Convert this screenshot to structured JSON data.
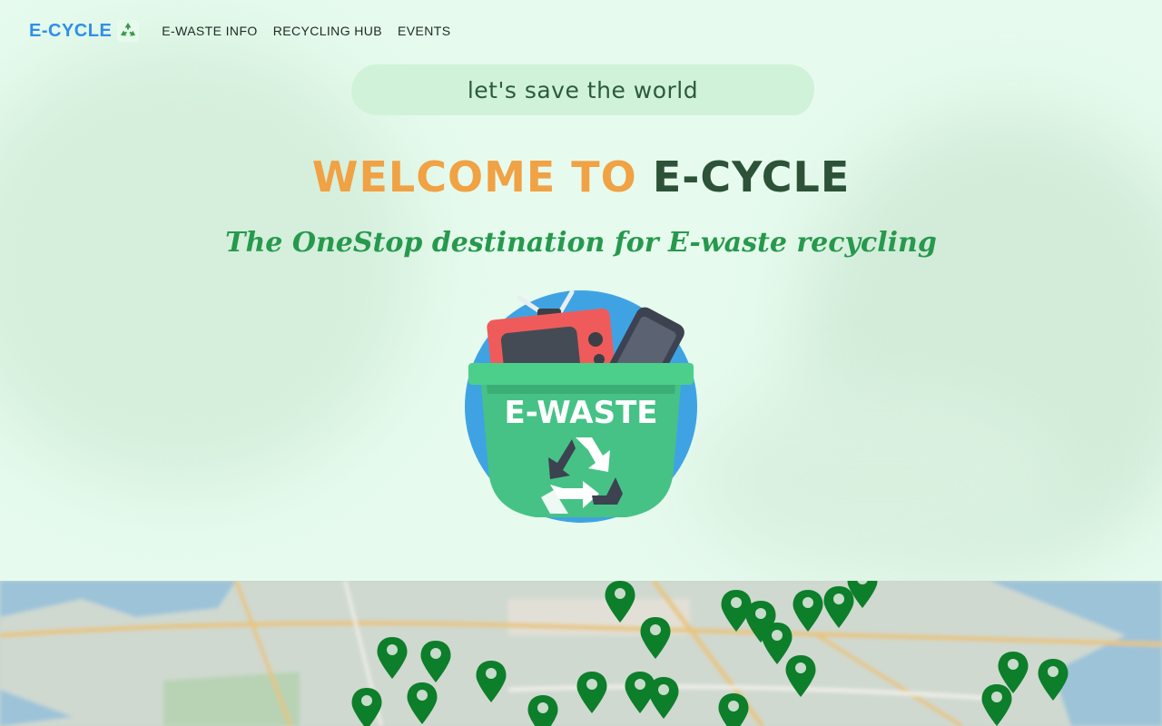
{
  "brand": {
    "name": "E-CYCLE",
    "icon": "recycle-icon",
    "color": "#2f8fe8"
  },
  "nav": {
    "items": [
      {
        "label": "E-WASTE INFO"
      },
      {
        "label": "RECYCLING HUB"
      },
      {
        "label": "EVENTS"
      }
    ]
  },
  "hero": {
    "tagline": "let's save the world",
    "welcome_prefix": "WELCOME TO",
    "welcome_brand": "E-CYCLE",
    "subtitle": "The OneStop destination for E-waste recycling",
    "illustration": {
      "label": "E-WASTE",
      "icons": [
        "tv-icon",
        "phone-icon",
        "recycle-icon"
      ]
    }
  },
  "map": {
    "marker_icon": "map-pin-icon",
    "marker_color": "#0e8a2b"
  },
  "colors": {
    "background": "#e6fbee",
    "accent_orange": "#f0a244",
    "dark_green": "#2c5238",
    "subtitle_green": "#26994d",
    "pill": "#d0f2d9"
  }
}
